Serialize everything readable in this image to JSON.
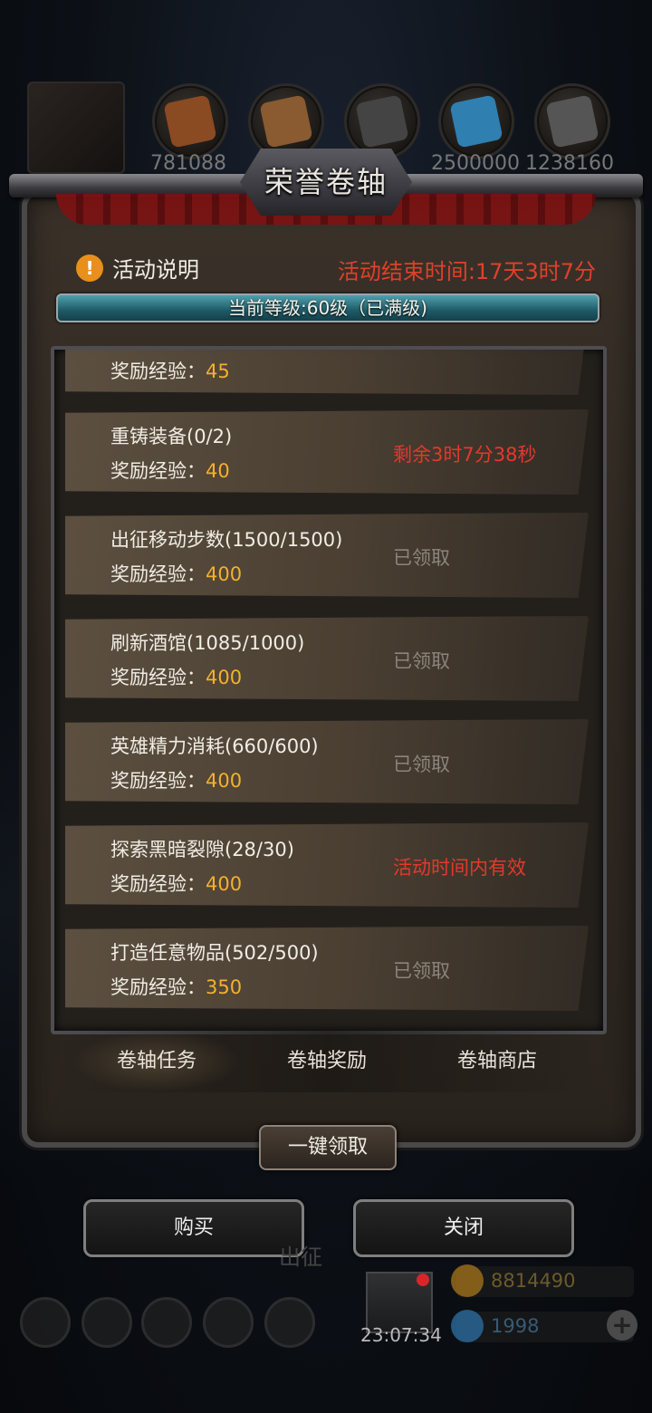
{
  "resources": {
    "counts": [
      "781088",
      "2500000",
      "1238160"
    ]
  },
  "title": "荣誉卷轴",
  "notice": {
    "label": "活动说明",
    "end_time": "活动结束时间:17天3时7分"
  },
  "level": {
    "text": "当前等级:60级（已满级)"
  },
  "tasks": [
    {
      "name": "",
      "reward_label": "奖励经验：",
      "reward_value": "45",
      "status": ""
    },
    {
      "name": "重铸装备(0/2)",
      "reward_label": "奖励经验：",
      "reward_value": "40",
      "status": "剩余3时7分38秒"
    },
    {
      "name": "出征移动步数(1500/1500)",
      "reward_label": "奖励经验：",
      "reward_value": "400",
      "status": "已领取"
    },
    {
      "name": "刷新酒馆(1085/1000)",
      "reward_label": "奖励经验：",
      "reward_value": "400",
      "status": "已领取"
    },
    {
      "name": "英雄精力消耗(660/600)",
      "reward_label": "奖励经验：",
      "reward_value": "400",
      "status": "已领取"
    },
    {
      "name": "探索黑暗裂隙(28/30)",
      "reward_label": "奖励经验：",
      "reward_value": "400",
      "status": "活动时间内有效"
    },
    {
      "name": "打造任意物品(502/500)",
      "reward_label": "奖励经验：",
      "reward_value": "350",
      "status": "已领取"
    }
  ],
  "tabs": [
    "卷轴任务",
    "卷轴奖励",
    "卷轴商店"
  ],
  "collect_all": "一键领取",
  "buttons": {
    "buy": "购买",
    "close": "关闭"
  },
  "hud": {
    "expedition": "出征",
    "clock": "23:07:34",
    "gold": "8814490",
    "gems": "1998"
  }
}
